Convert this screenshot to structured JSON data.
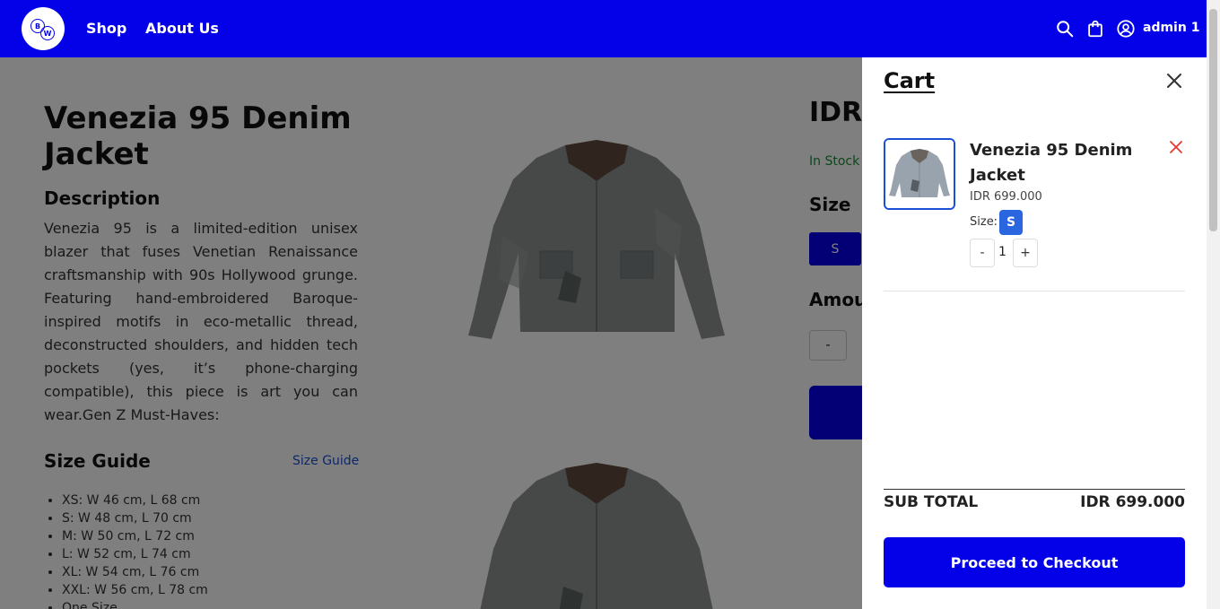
{
  "header": {
    "logo_letters": [
      "B",
      "W"
    ],
    "nav": [
      {
        "label": "Shop"
      },
      {
        "label": "About Us"
      }
    ],
    "icons": [
      "search-icon",
      "shopping-bag-icon",
      "user-circle-icon"
    ],
    "username": "admin 1",
    "bg_color": "#0400e8"
  },
  "product": {
    "title": "Venezia 95 Denim Jacket",
    "description_heading": "Description",
    "description": "Venezia 95 is a limited-edition unisex blazer that fuses Venetian Renaissance craftsmanship with 90s Hollywood grunge. Featuring hand-embroidered Baroque-inspired motifs in eco-metallic thread, deconstructed shoulders, and hidden tech pockets (yes, it’s phone-charging compatible), this piece is art you can wear.Gen Z Must-Haves:",
    "size_guide_heading": "Size Guide",
    "size_guide_link": "Size Guide",
    "size_guide_items": [
      "XS: W 46 cm, L 68 cm",
      "S: W 48 cm, L 70 cm",
      "M: W 50 cm, L 72 cm",
      "L: W 52 cm, L 74 cm",
      "XL: W 54 cm, L 76 cm",
      "XXL: W 56 cm, L 78 cm",
      "One Size"
    ],
    "price_partial": "IDR",
    "stock_partial": "In Stock",
    "size_heading": "Size",
    "selected_size": "S",
    "amount_heading_partial": "Amou",
    "amount_minus": "-"
  },
  "cart": {
    "title": "Cart",
    "items": [
      {
        "name": "Venezia 95 Denim Jacket",
        "price": "IDR 699.000",
        "size_label": "Size:",
        "size": "S",
        "qty_minus": "-",
        "qty": "1",
        "qty_plus": "+"
      }
    ],
    "subtotal_label": "SUB TOTAL",
    "subtotal_value": "IDR 699.000",
    "checkout_label": "Proceed to Checkout",
    "accent_color": "#0400e8",
    "remove_color": "#e53935"
  }
}
